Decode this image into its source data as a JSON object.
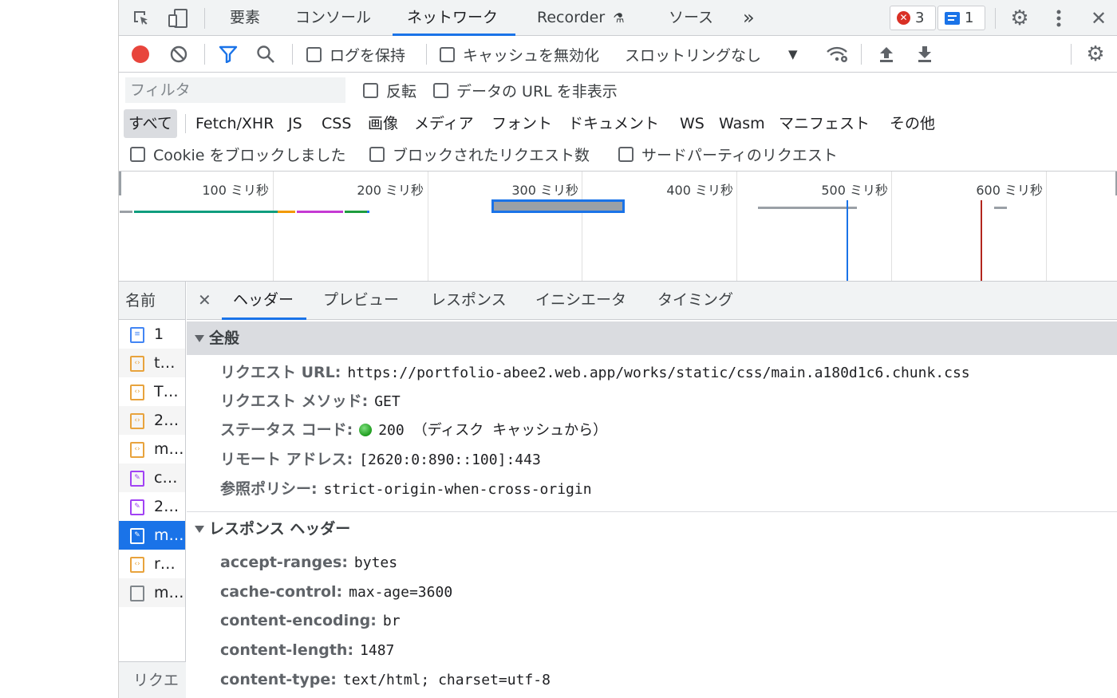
{
  "top_tabs": [
    "要素",
    "コンソール",
    "ネットワーク",
    "Recorder",
    "ソース"
  ],
  "more_tabs_label": "»",
  "errors_count": "3",
  "messages_count": "1",
  "toolbar": {
    "preserve_log_label": "ログを保持",
    "disable_cache_label": "キャッシュを無効化",
    "throttling_value": "スロットリングなし"
  },
  "filter": {
    "placeholder": "フィルタ",
    "invert_label": "反転",
    "hide_data_urls_label": "データの URL を非表示"
  },
  "type_filters": [
    "すべて",
    "Fetch/XHR",
    "JS",
    "CSS",
    "画像",
    "メディア",
    "フォント",
    "ドキュメント",
    "WS",
    "Wasm",
    "マニフェスト",
    "その他"
  ],
  "block_filters": [
    "Cookie をブロックしました",
    "ブロックされたリクエスト数",
    "サードパーティのリクエスト"
  ],
  "overview_ticks": [
    "100 ミリ秒",
    "200 ミリ秒",
    "300 ミリ秒",
    "400 ミリ秒",
    "500 ミリ秒",
    "600 ミリ秒"
  ],
  "name_column": {
    "header": "名前",
    "rows": [
      "1",
      "t…",
      "T…",
      "2…",
      "m…",
      "c…",
      "2…",
      "m…",
      "r…",
      "m…"
    ],
    "footer": "リクエ"
  },
  "detail_tabs": [
    "ヘッダー",
    "プレビュー",
    "レスポンス",
    "イニシエータ",
    "タイミング"
  ],
  "general": {
    "title": "全般",
    "request_url_label": "リクエスト URL:",
    "request_url": "https://portfolio-abee2.web.app/works/static/css/main.a180d1c6.chunk.css",
    "method_label": "リクエスト メソッド:",
    "method": "GET",
    "status_label": "ステータス コード:",
    "status": "200 （ディスク キャッシュから）",
    "remote_label": "リモート アドレス:",
    "remote": "[2620:0:890::100]:443",
    "referrer_label": "参照ポリシー:",
    "referrer": "strict-origin-when-cross-origin"
  },
  "response_headers": {
    "title": "レスポンス ヘッダー",
    "items": [
      {
        "key": "accept-ranges:",
        "value": "bytes"
      },
      {
        "key": "cache-control:",
        "value": "max-age=3600"
      },
      {
        "key": "content-encoding:",
        "value": "br"
      },
      {
        "key": "content-length:",
        "value": "1487"
      },
      {
        "key": "content-type:",
        "value": "text/html; charset=utf-8"
      }
    ]
  },
  "colors": {
    "accent": "#1a73e8",
    "record": "#e8453c",
    "selected_row": "#1a73e8"
  }
}
